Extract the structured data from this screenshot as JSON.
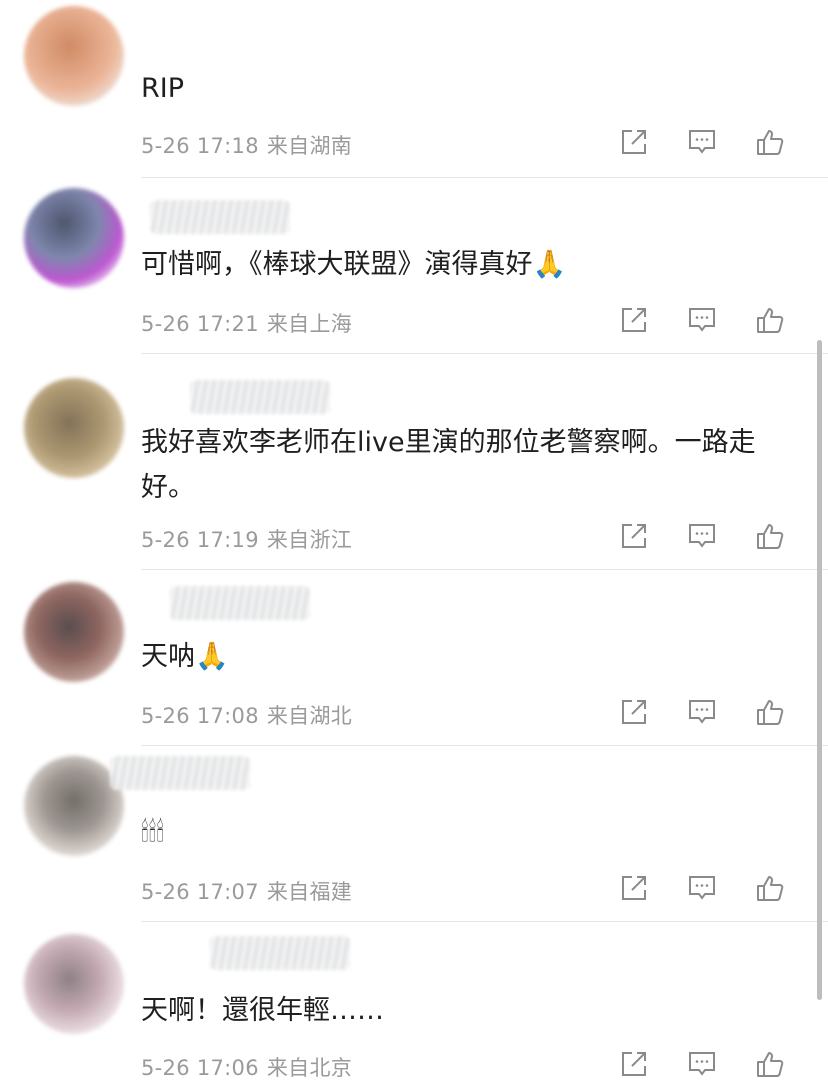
{
  "comments": [
    {
      "text": "RIP",
      "time": "5-26 17:18",
      "location": "来自湖南",
      "avatar_colors": [
        "#c8774a",
        "#e9a987",
        "#9b5a3a"
      ]
    },
    {
      "text": "可惜啊，《棒球大联盟》演得真好🙏",
      "time": "5-26 17:21",
      "location": "来自上海",
      "avatar_colors": [
        "#2f3a55",
        "#b23ac9",
        "#6a72a0"
      ]
    },
    {
      "text": "我好喜欢李老师在live里演的那位老警察啊。一路走好。",
      "time": "5-26 17:19",
      "location": "来自浙江",
      "avatar_colors": [
        "#a0875a",
        "#c9b389",
        "#6d5a3b"
      ]
    },
    {
      "text": "天呐🙏",
      "time": "5-26 17:08",
      "location": "来自湖北",
      "avatar_colors": [
        "#7b4b45",
        "#b08a80",
        "#3c2f30"
      ]
    },
    {
      "text": "🕯🕯🕯",
      "time": "5-26 17:07",
      "location": "来自福建",
      "avatar_colors": [
        "#8d8580",
        "#cfc6bf",
        "#5d5650"
      ]
    },
    {
      "text": "天啊！還很年輕……",
      "time": "5-26 17:06",
      "location": "来自北京",
      "avatar_colors": [
        "#b99aa5",
        "#e3d3d8",
        "#7c6b72"
      ]
    }
  ],
  "actions": {
    "share_icon": "share-icon",
    "comment_icon": "comment-icon",
    "like_icon": "thumbs-up-icon"
  },
  "colors": {
    "text": "#1f1f1f",
    "meta": "#9a9a9a",
    "icon": "#8a8a8a",
    "divider": "#e8e8e8"
  }
}
